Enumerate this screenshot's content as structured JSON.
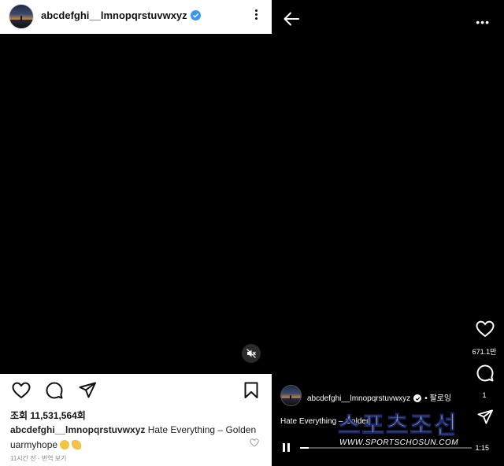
{
  "feed_post": {
    "username": "abcdefghi__lmnopqrstuvwxyz",
    "views": "조회 11,531,564회",
    "caption_username": "abcdefghi__lmnopqrstuvwxyz",
    "caption_text": "Hate Everything – Golden",
    "caption_line2": "uarmyhope",
    "timestamp": "11시간 전 · 번역 보기",
    "icons": [
      "heart-icon",
      "comment-icon",
      "share-icon",
      "bookmark-icon",
      "mute-icon",
      "more-icon",
      "verified-icon"
    ]
  },
  "reel": {
    "username": "abcdefghi__lmnopqrstuvwxyz",
    "follow_label": "• 팔로잉",
    "caption": "Hate Everything – Golden",
    "likes": "671.1만",
    "comments": "1",
    "elapsed_time": "1:15",
    "progress": 0.05,
    "icons": [
      "back-arrow-icon",
      "more-icon",
      "heart-icon",
      "comment-icon",
      "share-icon",
      "pause-icon",
      "verified-icon"
    ]
  },
  "watermark": {
    "main": "스포츠조선",
    "sub": "WWW.SPORTSCHOSUN.COM"
  },
  "colors": {
    "verified": "#3897f0",
    "background": "#000000",
    "panel": "#ffffff"
  }
}
